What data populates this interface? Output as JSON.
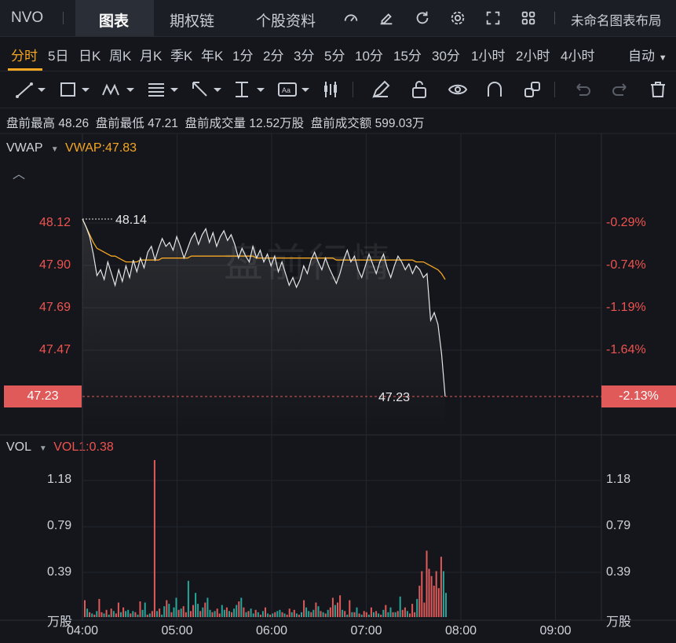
{
  "topbar": {
    "symbol": "NVO",
    "tabs": [
      {
        "label": "图表",
        "active": true
      },
      {
        "label": "期权链",
        "active": false
      },
      {
        "label": "个股资料",
        "active": false
      }
    ],
    "layout_name": "未命名图表布局"
  },
  "timeframes": {
    "items": [
      "分时",
      "5日",
      "日K",
      "周K",
      "月K",
      "季K",
      "年K",
      "1分",
      "2分",
      "3分",
      "5分",
      "10分",
      "15分",
      "30分",
      "1小时",
      "2小时",
      "4小时"
    ],
    "active_index": 0,
    "mode": "自动"
  },
  "info": {
    "premarket_high_label": "盘前最高",
    "premarket_high": "48.26",
    "premarket_low_label": "盘前最低",
    "premarket_low": "47.21",
    "premarket_volume_label": "盘前成交量",
    "premarket_volume": "12.52万股",
    "premarket_amount_label": "盘前成交额",
    "premarket_amount": "599.03万"
  },
  "indicators": {
    "main_name": "VWAP",
    "main_value": "VWAP:47.83",
    "vol_name": "VOL",
    "vol_value": "VOL1:0.38"
  },
  "watermark": "盘前行情",
  "price_axis": {
    "left_ticks": [
      "48.12",
      "47.90",
      "47.69",
      "47.47"
    ],
    "right_ticks": [
      "-0.29%",
      "-0.74%",
      "-1.19%",
      "-1.64%"
    ],
    "current_price": "47.23",
    "current_pct": "-2.13%",
    "high_label": "48.14",
    "last_label": "47.23"
  },
  "vol_axis": {
    "ticks": [
      "1.18",
      "0.79",
      "0.39"
    ],
    "unit": "万股"
  },
  "colors": {
    "up": "#e05a5a",
    "down": "#26a69a",
    "vwap": "#f5a623",
    "price_line": "#e6e6e6"
  },
  "chart_data": {
    "type": "line",
    "x_ticks": [
      "04:00",
      "05:00",
      "06:00",
      "07:00",
      "08:00",
      "09:00"
    ],
    "price_range": [
      47.23,
      48.26
    ],
    "price": [
      48.14,
      48.1,
      48.05,
      47.96,
      47.85,
      47.88,
      47.83,
      47.92,
      47.86,
      47.8,
      47.88,
      47.82,
      47.9,
      47.84,
      47.93,
      47.87,
      47.94,
      47.89,
      47.97,
      48.0,
      47.93,
      47.99,
      48.04,
      48.0,
      48.02,
      47.98,
      48.05,
      48.0,
      47.94,
      47.99,
      48.04,
      48.07,
      48.01,
      48.06,
      48.09,
      48.02,
      48.07,
      48.0,
      48.05,
      48.08,
      48.03,
      48.06,
      48.01,
      47.94,
      47.99,
      47.95,
      47.92,
      48.0,
      47.94,
      47.98,
      47.92,
      47.96,
      47.9,
      47.95,
      47.87,
      47.92,
      47.86,
      47.8,
      47.84,
      47.79,
      47.83,
      47.9,
      47.86,
      47.93,
      47.97,
      47.92,
      47.88,
      47.94,
      47.89,
      47.85,
      47.81,
      47.86,
      47.93,
      47.98,
      47.92,
      47.95,
      47.88,
      47.84,
      47.9,
      47.96,
      47.91,
      47.86,
      47.92,
      47.96,
      47.89,
      47.84,
      47.9,
      47.95,
      47.92,
      47.88,
      47.91,
      47.86,
      47.9,
      47.88,
      47.84,
      47.86,
      47.62,
      47.66,
      47.6,
      47.45,
      47.23
    ],
    "vwap": [
      48.14,
      48.1,
      48.06,
      48.02,
      47.99,
      47.98,
      47.97,
      47.96,
      47.95,
      47.95,
      47.94,
      47.93,
      47.92,
      47.92,
      47.92,
      47.92,
      47.93,
      47.93,
      47.93,
      47.93,
      47.93,
      47.93,
      47.94,
      47.94,
      47.94,
      47.94,
      47.94,
      47.94,
      47.94,
      47.94,
      47.95,
      47.95,
      47.95,
      47.95,
      47.95,
      47.95,
      47.95,
      47.95,
      47.95,
      47.95,
      47.95,
      47.95,
      47.95,
      47.95,
      47.95,
      47.95,
      47.95,
      47.95,
      47.94,
      47.94,
      47.94,
      47.94,
      47.94,
      47.94,
      47.94,
      47.94,
      47.94,
      47.94,
      47.94,
      47.94,
      47.94,
      47.94,
      47.94,
      47.94,
      47.94,
      47.94,
      47.94,
      47.94,
      47.94,
      47.94,
      47.93,
      47.93,
      47.93,
      47.93,
      47.93,
      47.93,
      47.93,
      47.93,
      47.93,
      47.93,
      47.93,
      47.93,
      47.93,
      47.93,
      47.93,
      47.93,
      47.93,
      47.93,
      47.93,
      47.93,
      47.93,
      47.93,
      47.92,
      47.92,
      47.92,
      47.91,
      47.9,
      47.89,
      47.88,
      47.86,
      47.83
    ],
    "volume": [
      0.14,
      0.07,
      0.04,
      0.03,
      0.02,
      0.05,
      0.15,
      0.04,
      0.03,
      0.06,
      0.02,
      0.07,
      0.05,
      0.03,
      0.12,
      0.04,
      0.08,
      0.05,
      0.06,
      0.03,
      0.05,
      0.04,
      0.02,
      0.13,
      0.06,
      0.12,
      0.02,
      0.03,
      0.05,
      1.3,
      0.05,
      0.07,
      0.02,
      0.09,
      0.14,
      0.11,
      0.04,
      0.08,
      0.16,
      0.06,
      0.07,
      0.09,
      0.04,
      0.3,
      0.05,
      0.1,
      0.2,
      0.11,
      0.05,
      0.08,
      0.12,
      0.16,
      0.06,
      0.04,
      0.05,
      0.07,
      0.03,
      0.1,
      0.06,
      0.08,
      0.05,
      0.04,
      0.07,
      0.1,
      0.13,
      0.16,
      0.08,
      0.04,
      0.05,
      0.07,
      0.03,
      0.06,
      0.04,
      0.02,
      0.05,
      0.08,
      0.03,
      0.02,
      0.03,
      0.04,
      0.05,
      0.06,
      0.04,
      0.03,
      0.02,
      0.07,
      0.04,
      0.06,
      0.03,
      0.02,
      0.04,
      0.14,
      0.08,
      0.05,
      0.04,
      0.06,
      0.12,
      0.09,
      0.05,
      0.04,
      0.03,
      0.06,
      0.08,
      0.16,
      0.1,
      0.12,
      0.18,
      0.06,
      0.05,
      0.02,
      0.14,
      0.04,
      0.04,
      0.08,
      0.03,
      0.02,
      0.05,
      0.04,
      0.02,
      0.08,
      0.04,
      0.05,
      0.03,
      0.02,
      0.06,
      0.1,
      0.04,
      0.08,
      0.04,
      0.04,
      0.05,
      0.17,
      0.06,
      0.08,
      0.05,
      0.03,
      0.11,
      0.04,
      0.15,
      0.26,
      0.38,
      0.12,
      0.55,
      0.4,
      0.34,
      0.26,
      0.38,
      0.24,
      0.5,
      0.38,
      0.2
    ],
    "volume_up": [
      1,
      0,
      1,
      0,
      1,
      0,
      1,
      1,
      0,
      1,
      0,
      1,
      0,
      1,
      1,
      0,
      1,
      0,
      0,
      1,
      0,
      1,
      0,
      1,
      0,
      0,
      1,
      0,
      1,
      1,
      0,
      1,
      0,
      0,
      1,
      0,
      1,
      0,
      0,
      1,
      0,
      1,
      1,
      0,
      1,
      1,
      0,
      0,
      1,
      0,
      1,
      0,
      0,
      1,
      0,
      1,
      1,
      0,
      0,
      1,
      0,
      1,
      0,
      0,
      1,
      0,
      1,
      0,
      1,
      0,
      0,
      1,
      0,
      1,
      0,
      1,
      0,
      1,
      0,
      1,
      0,
      0,
      1,
      0,
      1,
      1,
      0,
      1,
      0,
      1,
      0,
      1,
      0,
      0,
      1,
      0,
      1,
      0,
      1,
      0,
      1,
      0,
      1,
      1,
      0,
      1,
      1,
      0,
      1,
      0,
      1,
      0,
      1,
      0,
      1,
      0,
      1,
      1,
      0,
      1,
      0,
      1,
      0,
      1,
      0,
      1,
      0,
      0,
      1,
      0,
      1,
      0,
      1,
      1,
      0,
      1,
      1,
      1,
      0,
      1,
      1,
      1,
      1,
      1,
      1,
      1,
      1,
      1,
      1
    ],
    "volume_range": [
      0,
      1.38
    ]
  }
}
